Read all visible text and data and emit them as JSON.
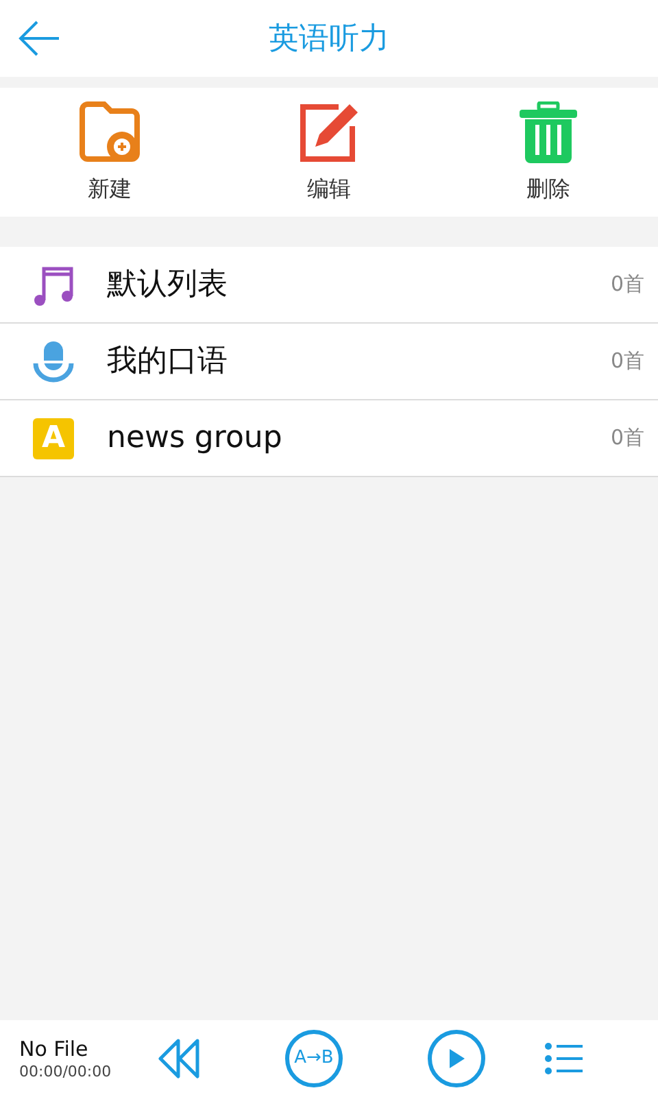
{
  "header": {
    "title": "英语听力"
  },
  "actions": [
    {
      "kind": "new",
      "label": "新建"
    },
    {
      "kind": "edit",
      "label": "编辑"
    },
    {
      "kind": "delete",
      "label": "删除"
    }
  ],
  "playlists": [
    {
      "kind": "music",
      "name": "默认列表",
      "count": "0首"
    },
    {
      "kind": "mic",
      "name": "我的口语",
      "count": "0首"
    },
    {
      "kind": "letter",
      "icon_text": "A",
      "name": "news group",
      "count": "0首"
    }
  ],
  "player": {
    "file": "No File",
    "time": "00:00/00:00",
    "ab_label": "A→B"
  }
}
